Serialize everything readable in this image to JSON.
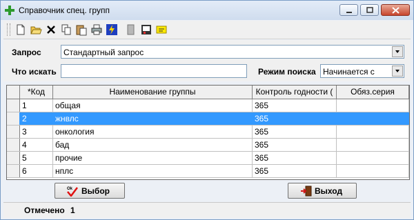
{
  "window": {
    "title": "Справочник спец. групп"
  },
  "toolbar": {
    "icons": [
      "new-icon",
      "open-icon",
      "delete-icon",
      "copy-icon",
      "paste-icon",
      "print-icon",
      "flash-icon",
      "save-icon",
      "preview-icon",
      "note-icon"
    ]
  },
  "query": {
    "label": "Запрос",
    "value": "Стандартный запрос"
  },
  "search": {
    "label": "Что искать",
    "value": "",
    "mode_label": "Режим поиска",
    "mode_value": "Начинается с"
  },
  "table": {
    "headers": [
      "*Код",
      "Наименование группы",
      "Контроль годности (",
      "Обяз.серия"
    ],
    "rows": [
      {
        "code": "1",
        "name": "общая",
        "control": "365",
        "series": ""
      },
      {
        "code": "2",
        "name": "жнвлс",
        "control": "365",
        "series": ""
      },
      {
        "code": "3",
        "name": "онкология",
        "control": "365",
        "series": ""
      },
      {
        "code": "4",
        "name": "бад",
        "control": "365",
        "series": ""
      },
      {
        "code": "5",
        "name": "прочие",
        "control": "365",
        "series": ""
      },
      {
        "code": "6",
        "name": "нплс",
        "control": "365",
        "series": ""
      }
    ],
    "selected_row": 2
  },
  "buttons": {
    "select_label": "Выбор",
    "exit_label": "Выход"
  },
  "status": {
    "label": "Отмечено",
    "value": "1"
  }
}
